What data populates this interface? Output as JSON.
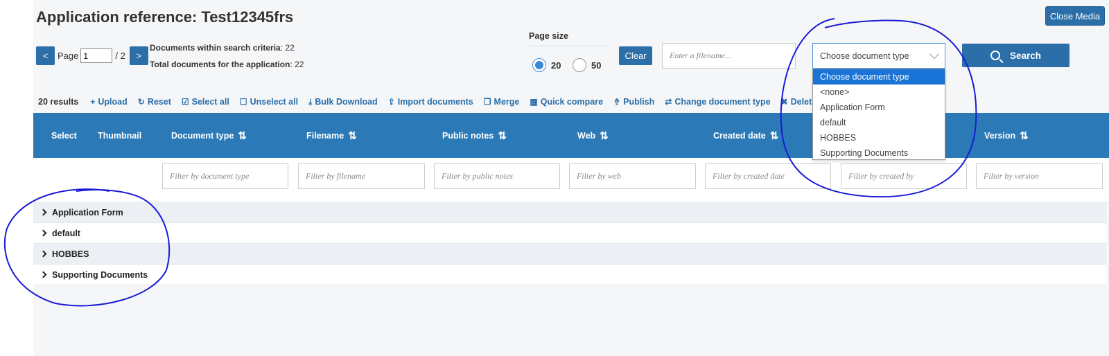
{
  "header": {
    "title": "Application reference: Test12345frs",
    "close_label": "Close Media"
  },
  "pager": {
    "prev": "<",
    "next": ">",
    "page_label": "Page",
    "page_value": "1",
    "total_pages": "/ 2"
  },
  "counts": {
    "within_label": "Documents within search criteria",
    "within_value": ": 22",
    "total_label": "Total documents for the application",
    "total_value": ": 22"
  },
  "page_size": {
    "label": "Page size",
    "options": [
      "20",
      "50"
    ],
    "selected": "20"
  },
  "search": {
    "clear_label": "Clear",
    "filename_placeholder": "Enter a filename...",
    "doctype_value": "Choose document type",
    "search_label": "Search"
  },
  "dropdown": {
    "options": [
      "Choose document type",
      "<none>",
      "Application Form",
      "default",
      "HOBBES",
      "Supporting Documents"
    ],
    "selected_index": 0
  },
  "toolbar": {
    "count": "20 results",
    "actions": [
      {
        "icon": "+",
        "label": "Upload"
      },
      {
        "icon": "↻",
        "label": "Reset"
      },
      {
        "icon": "☑",
        "label": "Select all"
      },
      {
        "icon": "☐",
        "label": "Unselect all"
      },
      {
        "icon": "⤓",
        "label": "Bulk Download"
      },
      {
        "icon": "⇪",
        "label": "Import documents"
      },
      {
        "icon": "❐",
        "label": "Merge"
      },
      {
        "icon": "▦",
        "label": "Quick compare"
      },
      {
        "icon": "⇮",
        "label": "Publish"
      },
      {
        "icon": "⇄",
        "label": "Change document type"
      },
      {
        "icon": "✖",
        "label": "Delete"
      }
    ]
  },
  "table": {
    "columns": [
      {
        "label": "Select",
        "sortable": false
      },
      {
        "label": "Thumbnail",
        "sortable": false
      },
      {
        "label": "Document type",
        "sortable": true
      },
      {
        "label": "Filename",
        "sortable": true
      },
      {
        "label": "Public notes",
        "sortable": true
      },
      {
        "label": "Web",
        "sortable": true
      },
      {
        "label": "Created date",
        "sortable": true
      },
      {
        "label": "",
        "sortable": false
      },
      {
        "label": "Version",
        "sortable": true
      }
    ],
    "filters": [
      "Filter by document type",
      "Filter by filename",
      "Filter by public notes",
      "Filter by web",
      "Filter by created date",
      "Filter by created by",
      "Filter by version"
    ],
    "groups": [
      "Application Form",
      "default",
      "HOBBES",
      "Supporting Documents"
    ]
  },
  "colors": {
    "primary": "#2b6ea8",
    "header_bg": "#2b7ab7",
    "dropdown_selected": "#1a73d6",
    "annotation": "#1a1ad6"
  }
}
